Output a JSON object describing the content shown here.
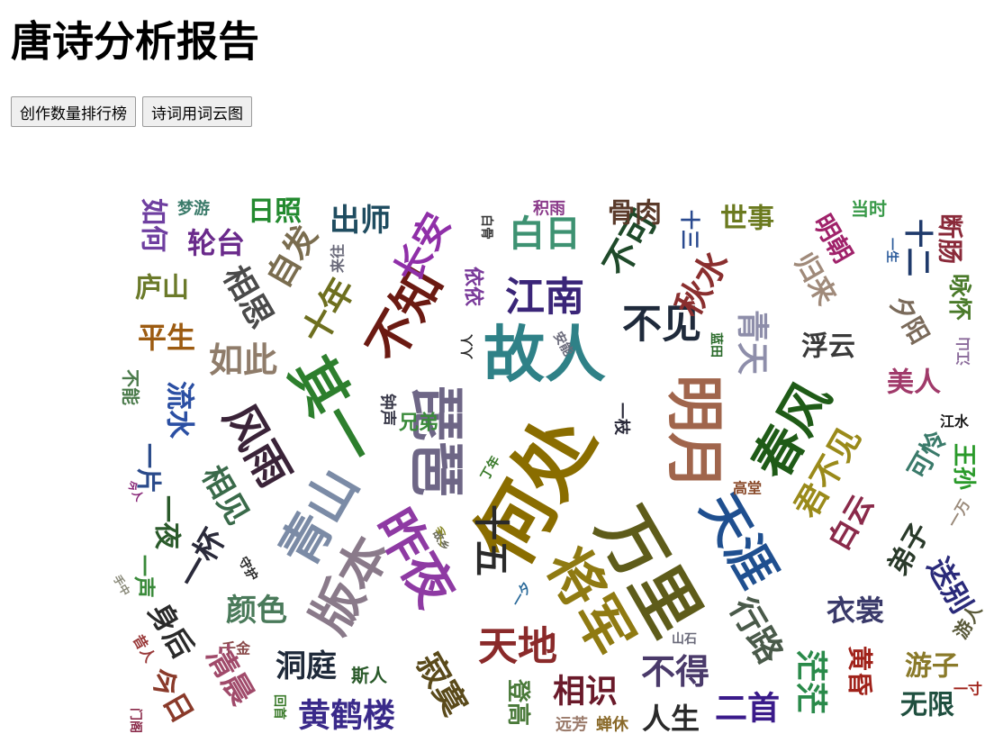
{
  "page": {
    "title": "唐诗分析报告"
  },
  "buttons": {
    "ranking": "创作数量排行榜",
    "wordcloud": "诗词用词云图"
  },
  "wordcloud": {
    "words": [
      {
        "text": "何处",
        "color": "#8a6d00",
        "rotate": -60
      },
      {
        "text": "万里",
        "color": "#5e5c1a",
        "rotate": 60
      },
      {
        "text": "故人",
        "color": "#2f8187",
        "rotate": 0
      },
      {
        "text": "琵琶",
        "color": "#6e6686",
        "rotate": 90
      },
      {
        "text": "明月",
        "color": "#a0654c",
        "rotate": 90
      },
      {
        "text": "将军",
        "color": "#8f7a12",
        "rotate": 60
      },
      {
        "text": "青山",
        "color": "#7b8ba6",
        "rotate": -60
      },
      {
        "text": "昨夜",
        "color": "#8e3aa3",
        "rotate": 60
      },
      {
        "text": "其一",
        "color": "#2d7f2d",
        "rotate": 60
      },
      {
        "text": "春风",
        "color": "#1f5b17",
        "rotate": -60
      },
      {
        "text": "天涯",
        "color": "#1f4f8f",
        "rotate": 60
      },
      {
        "text": "不知",
        "color": "#6b1a12",
        "rotate": -60
      },
      {
        "text": "风雨",
        "color": "#3a2338",
        "rotate": 60
      },
      {
        "text": "江南",
        "color": "#3a2578",
        "rotate": 0
      },
      {
        "text": "不见",
        "color": "#1f2a3b",
        "rotate": 0
      },
      {
        "text": "白日",
        "color": "#3e9272",
        "rotate": 0
      },
      {
        "text": "长安",
        "color": "#8f2fa8",
        "rotate": -60
      },
      {
        "text": "十年",
        "color": "#6e6f1f",
        "rotate": -60
      },
      {
        "text": "不可",
        "color": "#1f4a2a",
        "rotate": -60
      },
      {
        "text": "秋水",
        "color": "#8a2f2f",
        "rotate": -60
      },
      {
        "text": "青天",
        "color": "#8e8eaa",
        "rotate": 90
      },
      {
        "text": "如此",
        "color": "#8f7c6a",
        "rotate": 0
      },
      {
        "text": "相思",
        "color": "#4a4a4a",
        "rotate": 60
      },
      {
        "text": "自发",
        "color": "#7a6d4f",
        "rotate": -60
      },
      {
        "text": "出师",
        "color": "#1f4c60",
        "rotate": 0
      },
      {
        "text": "流水",
        "color": "#2b4fa3",
        "rotate": 90
      },
      {
        "text": "平生",
        "color": "#9c5b11",
        "rotate": 0
      },
      {
        "text": "庐山",
        "color": "#6b7a2a",
        "rotate": 0
      },
      {
        "text": "轮台",
        "color": "#6a2a8b",
        "rotate": 0
      },
      {
        "text": "如何",
        "color": "#6f3fa0",
        "rotate": 90
      },
      {
        "text": "梦游",
        "color": "#3b7b6a",
        "rotate": 0
      },
      {
        "text": "日照",
        "color": "#238a2f",
        "rotate": 0
      },
      {
        "text": "来往",
        "color": "#6a6a7a",
        "rotate": -90
      },
      {
        "text": "依依",
        "color": "#7a3a9a",
        "rotate": 90
      },
      {
        "text": "白骨",
        "color": "#3a3a3a",
        "rotate": 90
      },
      {
        "text": "积雨",
        "color": "#8a3a8a",
        "rotate": 0
      },
      {
        "text": "骨肉",
        "color": "#5a3a2a",
        "rotate": 0
      },
      {
        "text": "十三",
        "color": "#2a4a8f",
        "rotate": 90
      },
      {
        "text": "世事",
        "color": "#6b7a1f",
        "rotate": 0
      },
      {
        "text": "当时",
        "color": "#3a9a4a",
        "rotate": 0
      },
      {
        "text": "断肠",
        "color": "#8a2a3a",
        "rotate": 90
      },
      {
        "text": "十二",
        "color": "#1f3a6b",
        "rotate": 90
      },
      {
        "text": "一生",
        "color": "#2a5a9a",
        "rotate": 90
      },
      {
        "text": "明朝",
        "color": "#a0226a",
        "rotate": 60
      },
      {
        "text": "归来",
        "color": "#a08a7a",
        "rotate": 60
      },
      {
        "text": "夕阳",
        "color": "#7a6a5a",
        "rotate": 60
      },
      {
        "text": "咏怀",
        "color": "#4a7a2a",
        "rotate": 90
      },
      {
        "text": "浮云",
        "color": "#3a3a3a",
        "rotate": 0
      },
      {
        "text": "美人",
        "color": "#a03a6a",
        "rotate": 0
      },
      {
        "text": "江山",
        "color": "#8a6a9a",
        "rotate": -90
      },
      {
        "text": "江水",
        "color": "#1a1a1a",
        "rotate": 0
      },
      {
        "text": "王孙",
        "color": "#2a9a2a",
        "rotate": 90
      },
      {
        "text": "可怜",
        "color": "#3a7a6a",
        "rotate": -60
      },
      {
        "text": "君不见",
        "color": "#9a8a1a",
        "rotate": -60
      },
      {
        "text": "白云",
        "color": "#8a2a4a",
        "rotate": -60
      },
      {
        "text": "弟子",
        "color": "#2a3a2a",
        "rotate": -60
      },
      {
        "text": "一万",
        "color": "#9a8a7a",
        "rotate": -60
      },
      {
        "text": "送别",
        "color": "#2a2a7a",
        "rotate": 60
      },
      {
        "text": "游人",
        "color": "#5a5a3a",
        "rotate": -60
      },
      {
        "text": "衣裳",
        "color": "#3a3a6a",
        "rotate": 0
      },
      {
        "text": "黄昏",
        "color": "#a0221a",
        "rotate": 90
      },
      {
        "text": "游子",
        "color": "#8a7a2a",
        "rotate": 0
      },
      {
        "text": "一寸",
        "color": "#a0221a",
        "rotate": 0
      },
      {
        "text": "无限",
        "color": "#1f4f3f",
        "rotate": 0
      },
      {
        "text": "茫茫",
        "color": "#2a8a4a",
        "rotate": 90
      },
      {
        "text": "二首",
        "color": "#3a1a8a",
        "rotate": 0
      },
      {
        "text": "人生",
        "color": "#2a2a2a",
        "rotate": 0
      },
      {
        "text": "不得",
        "color": "#4a3a6a",
        "rotate": 0
      },
      {
        "text": "山石",
        "color": "#6a6a7a",
        "rotate": 0
      },
      {
        "text": "行路",
        "color": "#4a5a4a",
        "rotate": 60
      },
      {
        "text": "相识",
        "color": "#6a1a2a",
        "rotate": 0
      },
      {
        "text": "登高",
        "color": "#4a7a3a",
        "rotate": 90
      },
      {
        "text": "远芳",
        "color": "#9a7a6a",
        "rotate": 0
      },
      {
        "text": "蝉休",
        "color": "#8a6a2a",
        "rotate": 0
      },
      {
        "text": "天地",
        "color": "#8a2a2a",
        "rotate": 0
      },
      {
        "text": "寂寞",
        "color": "#5a4a1a",
        "rotate": 60
      },
      {
        "text": "十五",
        "color": "#2a2a2a",
        "rotate": 90
      },
      {
        "text": "一夕",
        "color": "#2a6a9a",
        "rotate": -60
      },
      {
        "text": "故乡",
        "color": "#6a6a5a",
        "rotate": 60
      },
      {
        "text": "黄鹤楼",
        "color": "#3a2a8a",
        "rotate": 0
      },
      {
        "text": "斯人",
        "color": "#2a5a2a",
        "rotate": 0
      },
      {
        "text": "洞庭",
        "color": "#1f2a3a",
        "rotate": 0
      },
      {
        "text": "千金",
        "color": "#8a4a4a",
        "rotate": 0
      },
      {
        "text": "回首",
        "color": "#3a7a2a",
        "rotate": 90
      },
      {
        "text": "清晨",
        "color": "#a04a6a",
        "rotate": 60
      },
      {
        "text": "颜色",
        "color": "#4a7a5a",
        "rotate": 0
      },
      {
        "text": "身后",
        "color": "#2a2a2a",
        "rotate": 60
      },
      {
        "text": "今日",
        "color": "#8a3a2a",
        "rotate": 60
      },
      {
        "text": "昔人",
        "color": "#9a3a3a",
        "rotate": 60
      },
      {
        "text": "门阁",
        "color": "#8a2a4a",
        "rotate": 90
      },
      {
        "text": "一声",
        "color": "#3a8a3a",
        "rotate": 90
      },
      {
        "text": "手中",
        "color": "#8a8a7a",
        "rotate": 60
      },
      {
        "text": "一杯",
        "color": "#2a2a3a",
        "rotate": -60
      },
      {
        "text": "守护",
        "color": "#2a2a2a",
        "rotate": 60
      },
      {
        "text": "相见",
        "color": "#3a6a4a",
        "rotate": 60
      },
      {
        "text": "一夜",
        "color": "#2a5a2a",
        "rotate": 90
      },
      {
        "text": "今人",
        "color": "#8a2a7a",
        "rotate": 60
      },
      {
        "text": "一片",
        "color": "#2a4a8a",
        "rotate": 90
      },
      {
        "text": "不能",
        "color": "#4a7a4a",
        "rotate": 90
      },
      {
        "text": "钟声",
        "color": "#3a3a4a",
        "rotate": 90
      },
      {
        "text": "兄弟",
        "color": "#3a8a3a",
        "rotate": 0
      },
      {
        "text": "人人",
        "color": "#2a2a2a",
        "rotate": -90
      },
      {
        "text": "安能",
        "color": "#6a6a7a",
        "rotate": 60
      },
      {
        "text": "丁年",
        "color": "#3a7a2a",
        "rotate": -60
      },
      {
        "text": "一枝",
        "color": "#2a2a3a",
        "rotate": 90
      },
      {
        "text": "高堂",
        "color": "#8a4a2a",
        "rotate": 0
      },
      {
        "text": "蓝田",
        "color": "#2a6a2a",
        "rotate": 90
      },
      {
        "text": "版本",
        "color": "#8a7a8a",
        "rotate": -60
      },
      {
        "text": "一乡",
        "color": "#8a8a2a",
        "rotate": -90
      }
    ]
  }
}
